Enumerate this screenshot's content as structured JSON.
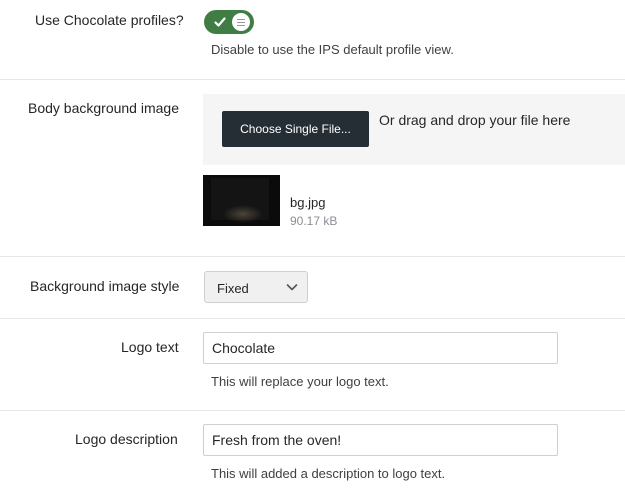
{
  "chocolate_profiles": {
    "label": "Use Chocolate profiles?",
    "enabled": true,
    "description": "Disable to use the IPS default profile view."
  },
  "body_background": {
    "label": "Body background image",
    "button_label": "Choose Single File...",
    "drag_text": "Or drag and drop your file here",
    "file": {
      "name": "bg.jpg",
      "size": "90.17 kB"
    }
  },
  "background_style": {
    "label": "Background image style",
    "selected": "Fixed"
  },
  "logo_text": {
    "label": "Logo text",
    "value": "Chocolate",
    "description": "This will replace your logo text."
  },
  "logo_description": {
    "label": "Logo description",
    "value": "Fresh from the oven!",
    "description": "This will added a description to logo text."
  },
  "colors": {
    "toggle_on": "#3f7d45",
    "button_dark": "#262e35",
    "upload_bg": "#f5f5f5",
    "divider": "#e6e6e6"
  }
}
